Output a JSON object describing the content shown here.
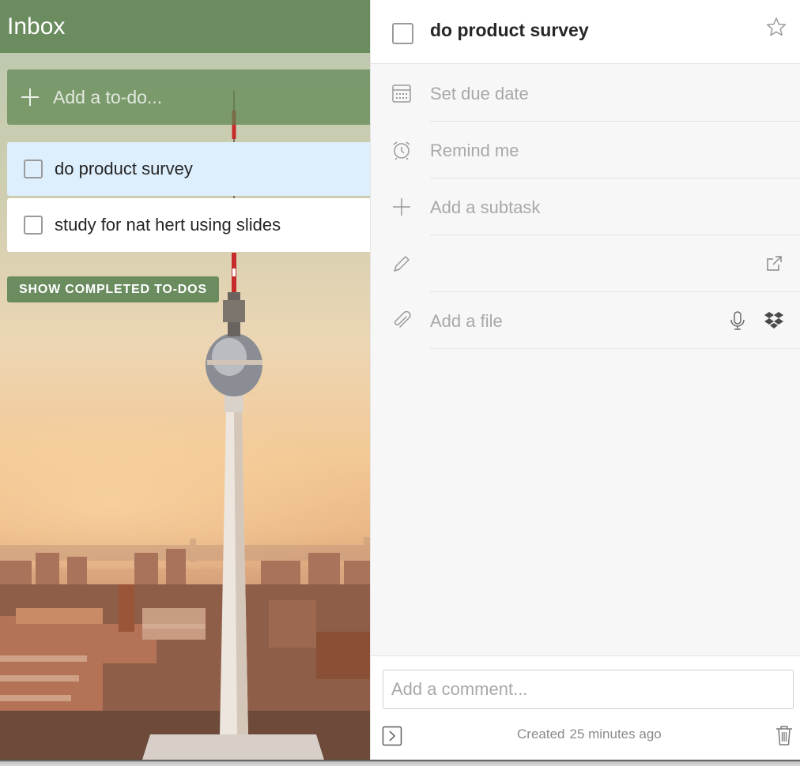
{
  "sidebar": {
    "list_title": "Inbox",
    "add_todo_placeholder": "Add a to-do...",
    "tasks": [
      {
        "label": "do product survey",
        "selected": true
      },
      {
        "label": "study for nat hert using slides",
        "selected": false
      }
    ],
    "show_completed_label": "SHOW COMPLETED TO-DOS"
  },
  "detail": {
    "task_title": "do product survey",
    "due_date_label": "Set due date",
    "remind_label": "Remind me",
    "subtask_label": "Add a subtask",
    "note_value": "",
    "file_label": "Add a file",
    "comment_placeholder": "Add a comment...",
    "created_label": "Created",
    "created_time": "25 minutes ago"
  },
  "icons": {
    "add": "plus-icon",
    "checkbox": "checkbox",
    "star": "star-icon",
    "calendar": "calendar-icon",
    "alarm": "alarm-clock-icon",
    "subtask": "plus-icon",
    "note": "pencil-icon",
    "external": "external-link-icon",
    "attach": "paperclip-icon",
    "mic": "microphone-icon",
    "dropbox": "dropbox-icon",
    "collapse": "collapse-panel-icon",
    "trash": "trash-icon"
  },
  "colors": {
    "accent_green": "#6a8c5f",
    "selected_task_bg": "#ddeefc",
    "detail_bg": "#f7f7f7"
  }
}
